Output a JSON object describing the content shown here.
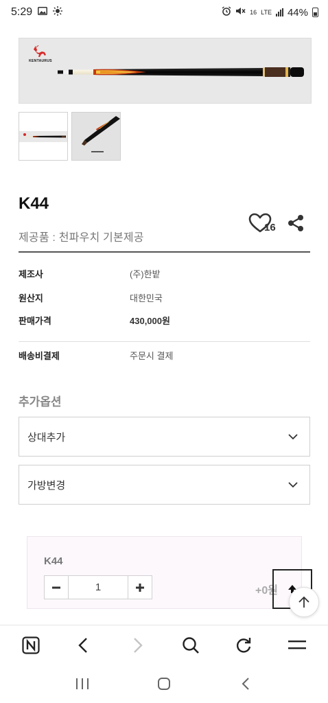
{
  "status_bar": {
    "time": "5:29",
    "network_speed": "16",
    "network_type": "LTE",
    "battery_percent": "44%"
  },
  "product": {
    "brand_logo_text": "KENTAURUS",
    "name": "K44",
    "subtitle": "제공품 : 천파우치 기본제공",
    "wishlist_count": "16"
  },
  "info": [
    {
      "label": "제조사",
      "value": "(주)한밭"
    },
    {
      "label": "원산지",
      "value": "대한민국"
    },
    {
      "label": "판매가격",
      "value": "430,000원"
    },
    {
      "label": "배송비결제",
      "value": "주문시 결제"
    }
  ],
  "options": {
    "heading": "추가옵션",
    "selects": [
      "상대추가",
      "가방변경"
    ]
  },
  "selected_item": {
    "name": "K44",
    "quantity": "1",
    "price": "+0원"
  }
}
